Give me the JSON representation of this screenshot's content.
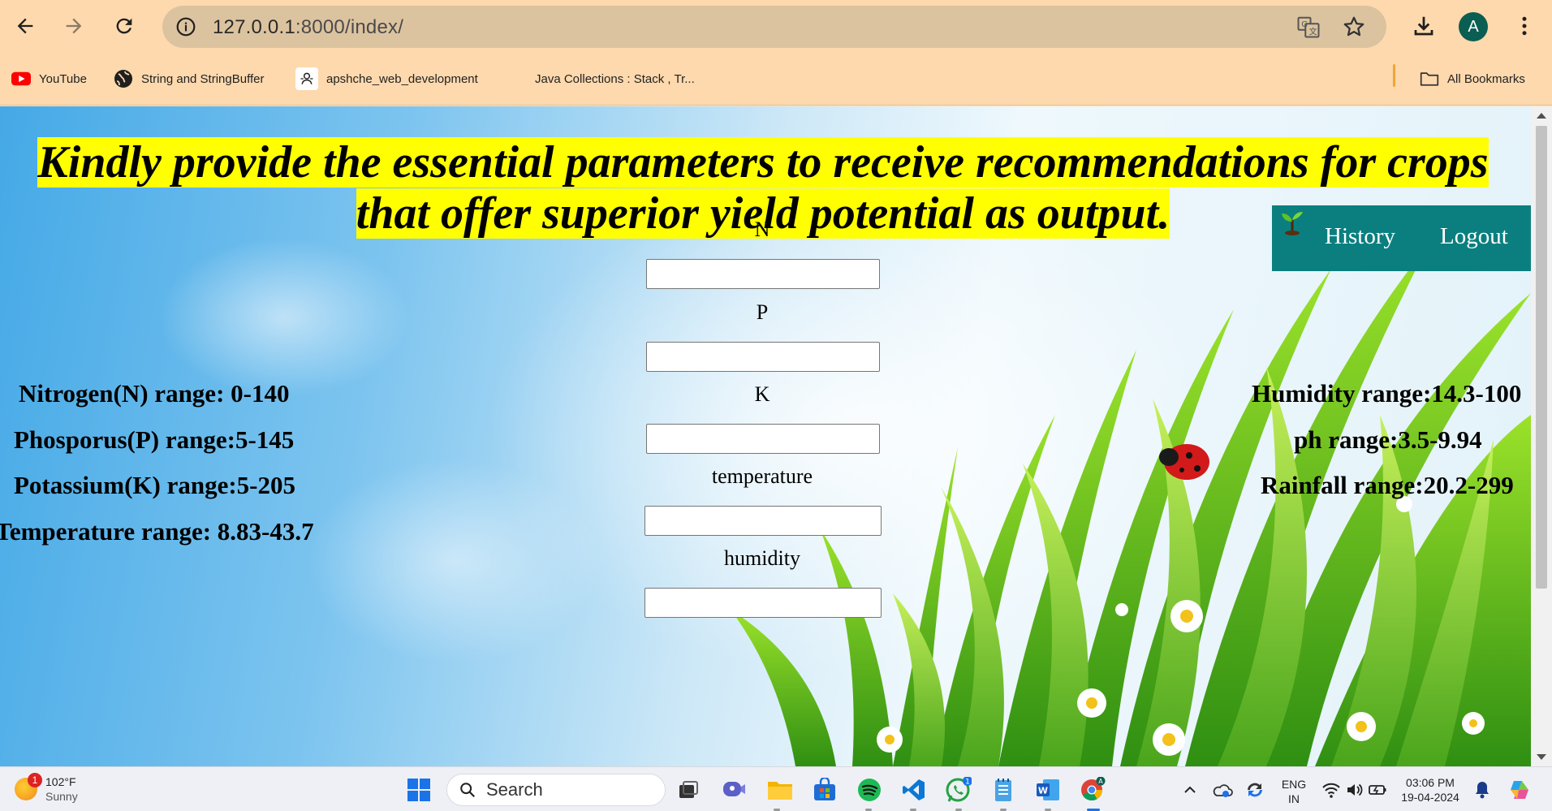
{
  "browser": {
    "url_host": "127.0.0.1",
    "url_rest": ":8000/index/",
    "profile_initial": "A",
    "bookmarks": [
      {
        "label": "YouTube",
        "icon": "youtube-icon"
      },
      {
        "label": "String and StringBuffer",
        "icon": "globe-icon"
      },
      {
        "label": "apshche_web_development",
        "icon": "github-icon"
      },
      {
        "label": "Java Collections : Stack , Tr...",
        "icon": "none"
      }
    ],
    "all_bookmarks_label": "All Bookmarks"
  },
  "page": {
    "heading": "Kindly provide the essential parameters to receive recommendations for crops that offer superior yield potential as output.",
    "nav": {
      "history": "History",
      "logout": "Logout"
    },
    "fields": [
      {
        "label": "N",
        "value": ""
      },
      {
        "label": "P",
        "value": ""
      },
      {
        "label": "K",
        "value": ""
      },
      {
        "label": "temperature",
        "value": ""
      },
      {
        "label": "humidity",
        "value": ""
      }
    ],
    "left_ranges": [
      "Nitrogen(N) range: 0-140",
      "Phosporus(P) range:5-145",
      "Potassium(K) range:5-205",
      "Temperature range: 8.83-43.7"
    ],
    "right_ranges": [
      "Humidity range:14.3-100",
      "ph range:3.5-9.94",
      "Rainfall range:20.2-299"
    ]
  },
  "taskbar": {
    "weather_temp": "102°F",
    "weather_desc": "Sunny",
    "weather_badge": "1",
    "search_label": "Search",
    "whatsapp_badge": "1",
    "lang_primary": "ENG",
    "lang_region": "IN",
    "time": "03:06 PM",
    "date": "19-04-2024"
  },
  "colors": {
    "chrome_bg": "#fdd9ad",
    "heading_highlight": "#ffff00",
    "nav_bg": "#0b7f7f"
  }
}
